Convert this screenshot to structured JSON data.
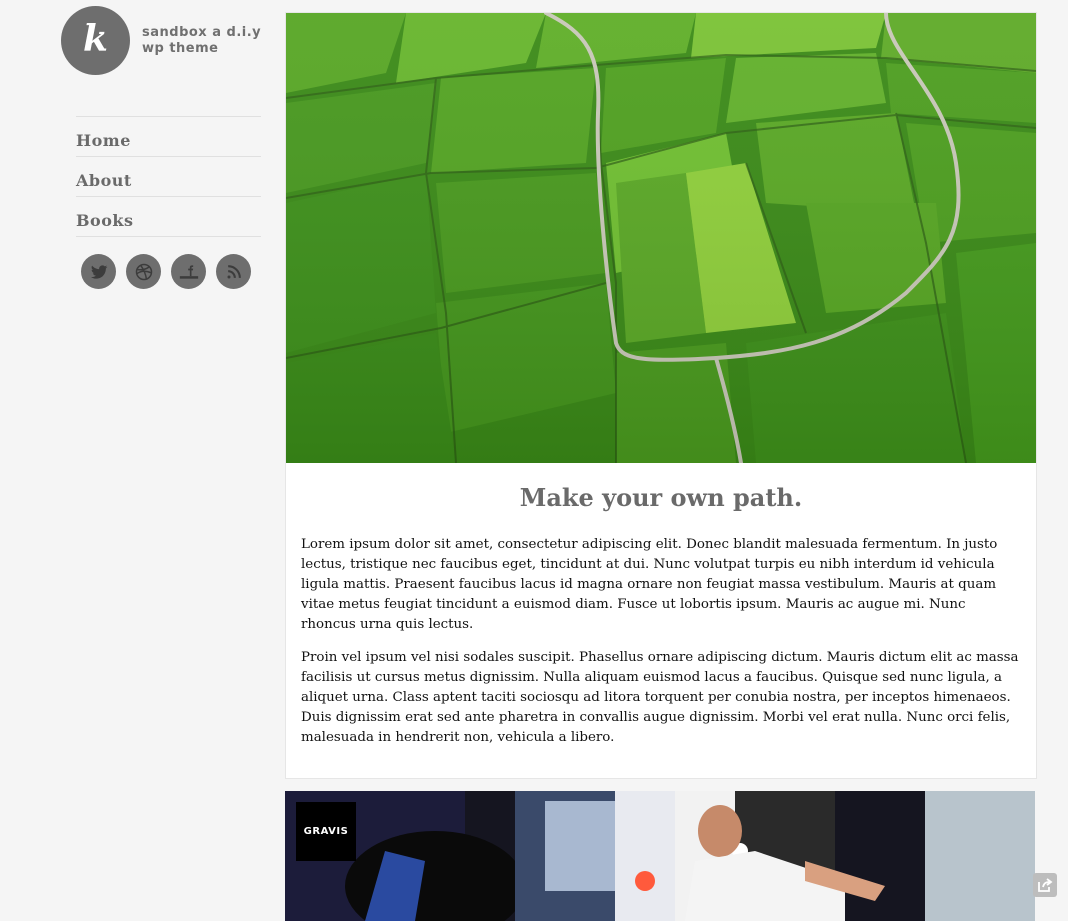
{
  "site": {
    "logo_letter": "k",
    "tagline_line1": "sandbox a d.i.y",
    "tagline_line2": "wp theme"
  },
  "nav": {
    "items": [
      {
        "label": "Home"
      },
      {
        "label": "About"
      },
      {
        "label": "Books"
      }
    ]
  },
  "social": {
    "icons": [
      "twitter-icon",
      "dribbble-icon",
      "facebook-icon",
      "rss-icon"
    ]
  },
  "post": {
    "image": "aerial-rice-fields-photo",
    "title": "Make your own path.",
    "paragraphs": [
      "Lorem ipsum dolor sit amet, consectetur adipiscing elit. Donec blandit malesuada fermentum. In justo lectus, tristique nec faucibus eget, tincidunt at dui. Nunc volutpat turpis eu nibh interdum id vehicula ligula mattis. Praesent faucibus lacus id magna ornare non feugiat massa vestibulum. Mauris at quam vitae metus feugiat tincidunt a euismod diam. Fusce ut lobortis ipsum. Mauris ac augue mi. Nunc rhoncus urna quis lectus.",
      "Proin vel ipsum vel nisi sodales suscipit. Phasellus ornare adipiscing dictum. Mauris dictum elit ac massa facilisis ut cursus metus dignissim. Nulla aliquam euismod lacus a faucibus. Quisque sed nunc ligula, a aliquet urna. Class aptent taciti sociosqu ad litora torquent per conubia nostra, per inceptos himenaeos. Duis dignissim erat sed ante pharetra in convallis augue dignissim. Morbi vel erat nulla. Nunc orci felis, malesuada in hendrerit non, vehicula a libero."
    ]
  },
  "post2": {
    "image": "gravis-photo",
    "badge": "GRAVIS"
  },
  "colors": {
    "background": "#f5f5f5",
    "accent_gray": "#6e6e6e",
    "field_green": "#3f8b17"
  }
}
